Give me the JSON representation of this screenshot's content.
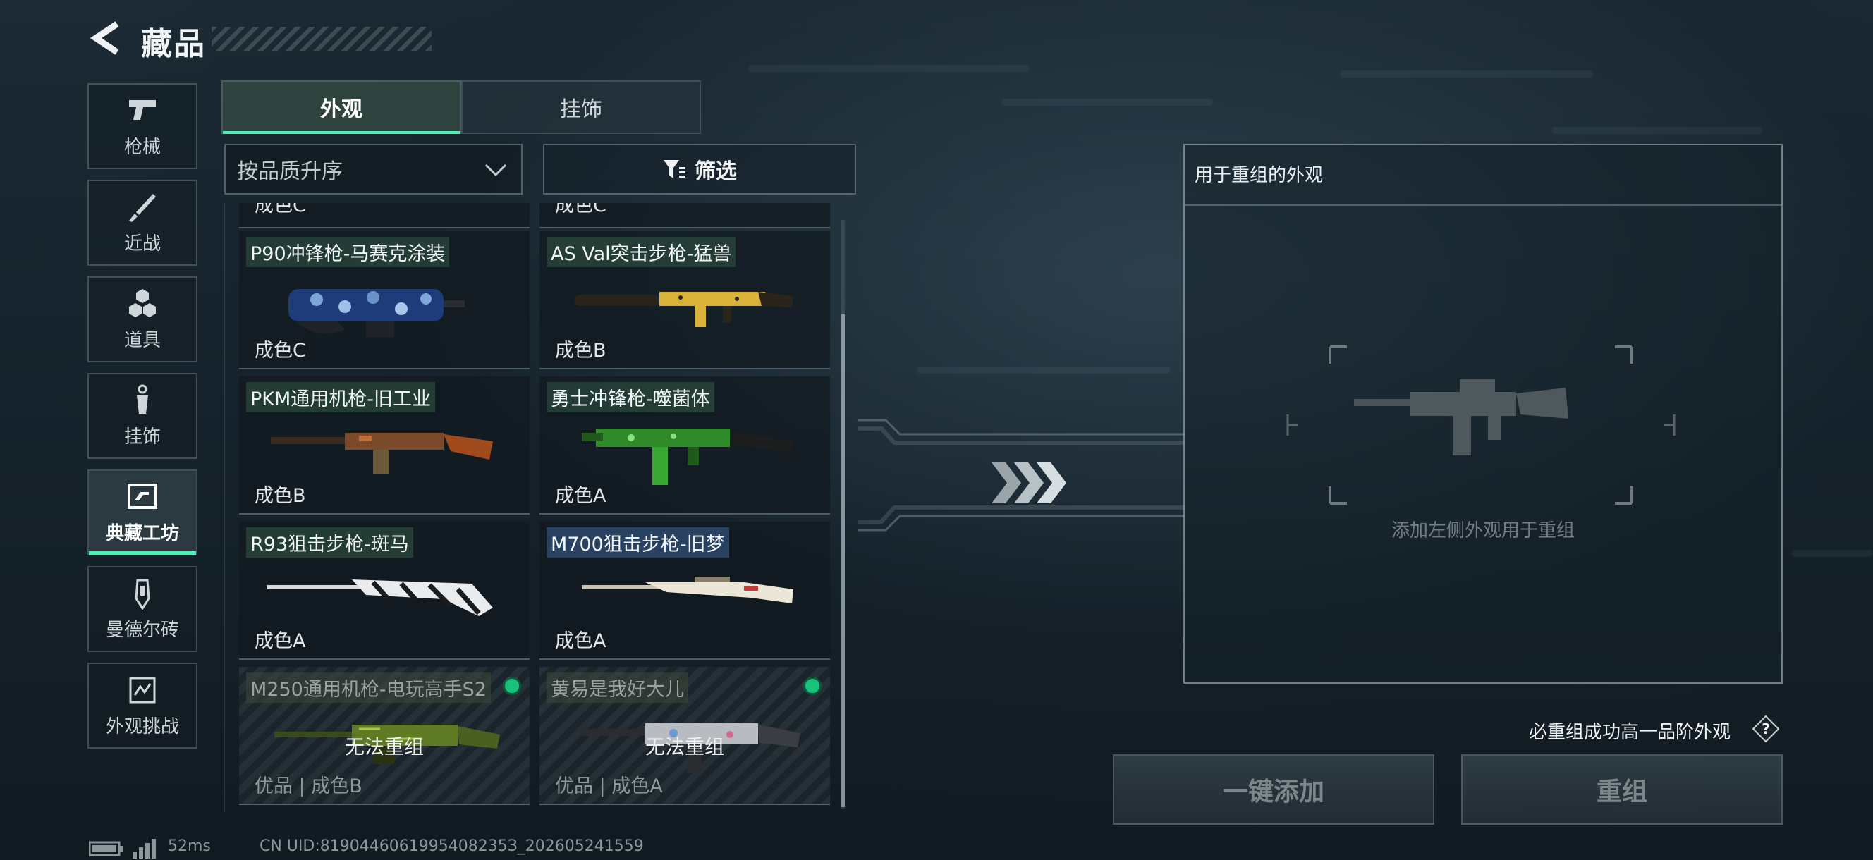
{
  "header": {
    "title": "藏品"
  },
  "sidebar": {
    "items": [
      {
        "label": "枪械",
        "icon": "pistol-icon",
        "active": false
      },
      {
        "label": "近战",
        "icon": "knife-icon",
        "active": false
      },
      {
        "label": "道具",
        "icon": "grenade-icon",
        "active": false
      },
      {
        "label": "挂饰",
        "icon": "charm-icon",
        "active": false
      },
      {
        "label": "典藏工坊",
        "icon": "workshop-icon",
        "active": true
      },
      {
        "label": "曼德尔砖",
        "icon": "brick-icon",
        "active": false
      },
      {
        "label": "外观挑战",
        "icon": "challenge-icon",
        "active": false
      }
    ]
  },
  "tabs": [
    {
      "label": "外观",
      "active": true
    },
    {
      "label": "挂饰",
      "active": false
    }
  ],
  "sort": {
    "value": "按品质升序"
  },
  "filter": {
    "label": "筛选"
  },
  "grid": {
    "partial_row": [
      "成色C",
      "成色C"
    ],
    "items": [
      {
        "name": "P90冲锋枪-马赛克涂装",
        "grade": "成色C",
        "locked": false,
        "name_style": "green",
        "gun": "p90"
      },
      {
        "name": "AS Val突击步枪-猛兽",
        "grade": "成色B",
        "locked": false,
        "name_style": "green",
        "gun": "asval"
      },
      {
        "name": "PKM通用机枪-旧工业",
        "grade": "成色B",
        "locked": false,
        "name_style": "green",
        "gun": "pkm"
      },
      {
        "name": "勇士冲锋枪-噬菌体",
        "grade": "成色A",
        "locked": false,
        "name_style": "green",
        "gun": "smg"
      },
      {
        "name": "R93狙击步枪-斑马",
        "grade": "成色A",
        "locked": false,
        "name_style": "green",
        "gun": "r93"
      },
      {
        "name": "M700狙击步枪-旧梦",
        "grade": "成色A",
        "locked": false,
        "name_style": "blue",
        "gun": "m700"
      },
      {
        "name": "M250通用机枪-电玩高手S2",
        "grade": "优品 | 成色B",
        "locked": true,
        "lock_text": "无法重组",
        "name_style": "locked",
        "gun": "m250"
      },
      {
        "name": "黄易是我好大儿",
        "grade": "优品 | 成色A",
        "locked": true,
        "lock_text": "无法重组",
        "name_style": "locked",
        "gun": "rifle"
      }
    ]
  },
  "panel": {
    "title": "用于重组的外观",
    "placeholder": "添加左侧外观用于重组"
  },
  "hint": {
    "text": "必重组成功高一品阶外观",
    "icon": "help-icon"
  },
  "buttons": {
    "add_all": "一键添加",
    "recombine": "重组"
  },
  "status": {
    "ping": "52ms",
    "uid": "CN UID:8190446061995408235З_202605241559"
  },
  "colors": {
    "accent": "#4ff0b8",
    "background": "#17242d",
    "locked_dot": "#19c27b"
  }
}
